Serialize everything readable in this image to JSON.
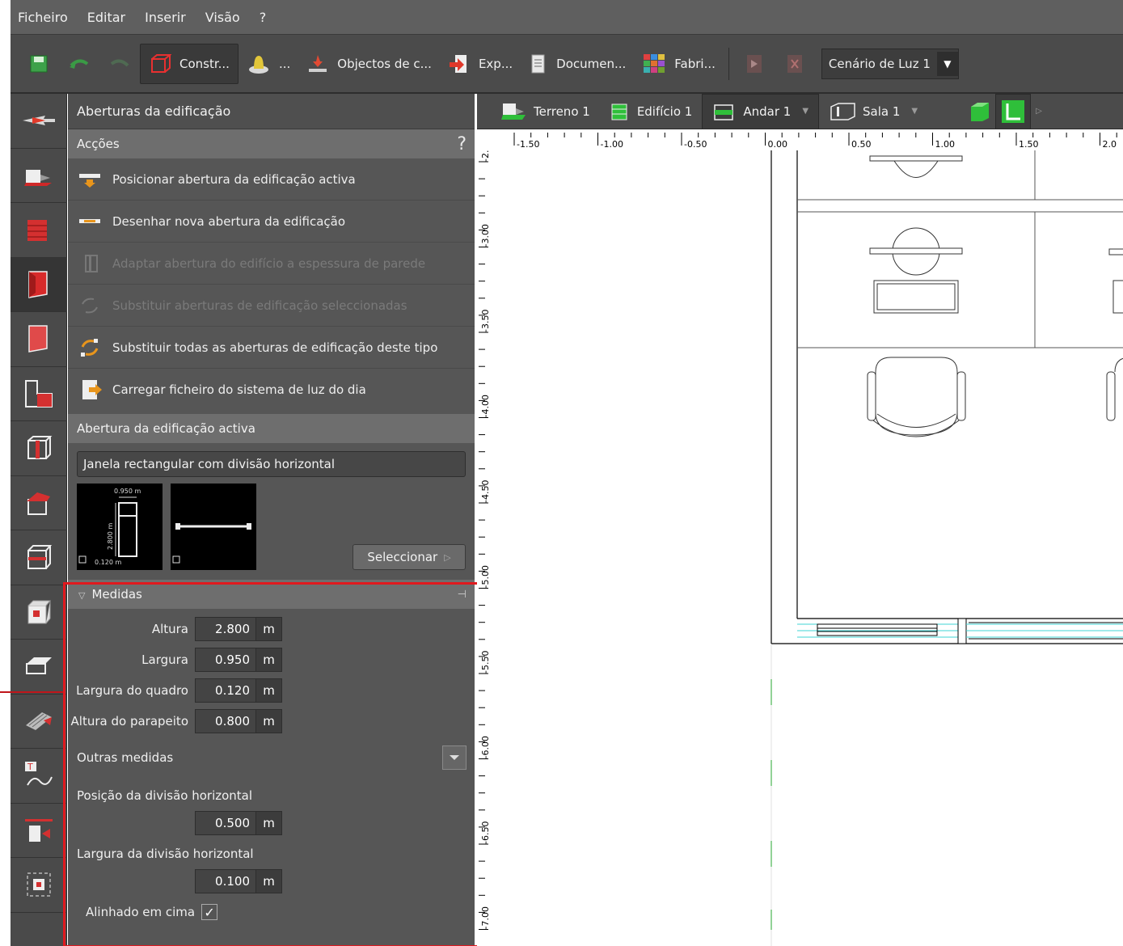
{
  "menu": [
    "Ficheiro",
    "Editar",
    "Inserir",
    "Visão",
    "?"
  ],
  "toolbar": {
    "construct_label": "Constr...",
    "light_label": "...",
    "objects_label": "Objectos de c...",
    "export_label": "Exp...",
    "documents_label": "Documen...",
    "manufacturers_label": "Fabri...",
    "light_scene_value": "Cenário de Luz 1"
  },
  "panel": {
    "title": "Aberturas da edificação",
    "actions_header": "Acções",
    "help": "?",
    "actions": [
      {
        "label": "Posicionar abertura da edificação activa",
        "enabled": true
      },
      {
        "label": "Desenhar nova abertura da edificação",
        "enabled": true
      },
      {
        "label": "Adaptar abertura do edifício a espessura de parede",
        "enabled": false
      },
      {
        "label": "Substituir aberturas de edificação seleccionadas",
        "enabled": false
      },
      {
        "label": "Substituir todas as aberturas de edificação deste tipo",
        "enabled": true
      },
      {
        "label": "Carregar ficheiro do sistema de luz do dia",
        "enabled": true
      }
    ],
    "active_header": "Abertura da edificação activa",
    "opening_name": "Janela rectangular com divisão horizontal",
    "preview": {
      "width_text": "0.950 m",
      "height_text": "2.800 m",
      "frame_text": "0.120 m"
    },
    "select_button": "Seleccionar",
    "measures_header": "Medidas",
    "measures": [
      {
        "label": "Altura",
        "value": "2.800",
        "unit": "m"
      },
      {
        "label": "Largura",
        "value": "0.950",
        "unit": "m"
      },
      {
        "label": "Largura do quadro",
        "value": "0.120",
        "unit": "m"
      },
      {
        "label": "Altura do parapeito",
        "value": "0.800",
        "unit": "m"
      }
    ],
    "other_measures": "Outras medidas",
    "divider_pos_label": "Posição da divisão horizontal",
    "divider_pos_value": "0.500",
    "divider_width_label": "Largura da divisão horizontal",
    "divider_width_value": "0.100",
    "unit": "m",
    "aligned_top_label": "Alinhado em cima"
  },
  "view_tabs": [
    "Terreno 1",
    "Edifício 1",
    "Andar 1",
    "Sala 1"
  ],
  "ruler": {
    "top_labels": [
      "-1.50",
      "-1.00",
      "-0.50",
      "0.00",
      "0.50",
      "1.00",
      "1.50",
      "2.0"
    ],
    "left_labels": [
      "-2.",
      "-3.00",
      "-3.50",
      "-4.00",
      "-4.50",
      "-5.00",
      "-5.50",
      "-6.00",
      "-6.50",
      "-7.00"
    ]
  },
  "colors": {
    "highlight": "#e0191e",
    "accent_green": "#2fbf3a",
    "accent_red": "#c8262b"
  }
}
